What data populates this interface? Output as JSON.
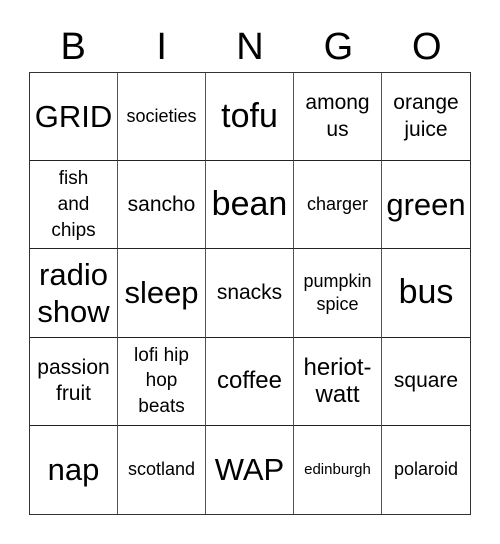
{
  "header": {
    "letters": [
      "B",
      "I",
      "N",
      "G",
      "O"
    ]
  },
  "grid": {
    "rows": [
      [
        "GRID",
        "societies",
        "tofu",
        "among us",
        "orange juice"
      ],
      [
        "fish and chips",
        "sancho",
        "bean",
        "charger",
        "green"
      ],
      [
        "radio show",
        "sleep",
        "snacks",
        "pumpkin spice",
        "bus"
      ],
      [
        "passion fruit",
        "lofi hip hop beats",
        "coffee",
        "heriot-watt",
        "square"
      ],
      [
        "nap",
        "scotland",
        "WAP",
        "edinburgh",
        "polaroid"
      ]
    ]
  },
  "colors": {
    "background": "#ffffff",
    "text": "#000000",
    "grid_line": "#333333"
  }
}
